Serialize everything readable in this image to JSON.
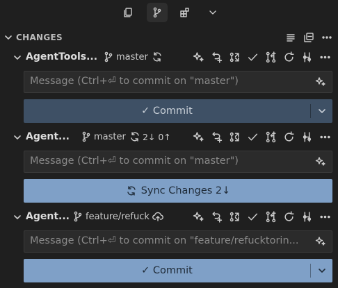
{
  "section": {
    "title": "CHANGES"
  },
  "view_switcher": {
    "icons": [
      "copy-icon",
      "source-control-icon",
      "extensions-icon",
      "chevron-down-icon"
    ]
  },
  "repos": [
    {
      "name": "AgentTools...",
      "branch": "master",
      "message_placeholder": "Message (Ctrl+⏎ to commit on \"master\")",
      "primary_action": "✓ Commit",
      "primary_style": "dim"
    },
    {
      "name": "Agent...",
      "branch": "master",
      "sync_counts": "2↓ 0↑",
      "message_placeholder": "Message (Ctrl+⏎ to commit on \"master\")",
      "primary_action": "Sync Changes 2↓",
      "primary_style": "bright"
    },
    {
      "name": "Agent...",
      "branch": "feature/refuck",
      "message_placeholder": "Message (Ctrl+⏎ to commit on \"feature/refucktorin...",
      "primary_action": "✓ Commit",
      "primary_style": "bright"
    }
  ]
}
